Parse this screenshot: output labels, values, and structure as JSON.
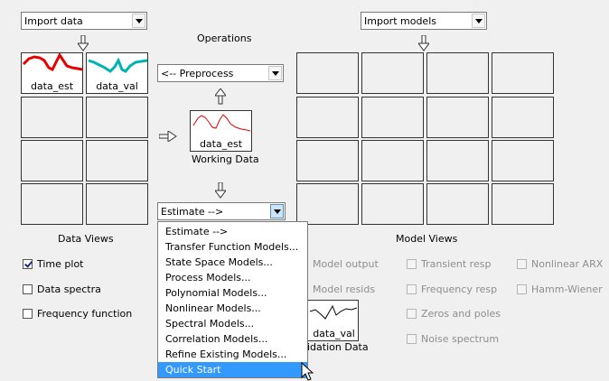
{
  "import_data": {
    "value": "Import data"
  },
  "import_models": {
    "value": "Import models"
  },
  "operations": {
    "title": "Operations",
    "preprocess": "<-- Preprocess",
    "estimate": "Estimate -->"
  },
  "data_views": {
    "title": "Data Views",
    "tiles": [
      {
        "label": "data_est",
        "color": "#e60000"
      },
      {
        "label": "data_val",
        "color": "#00b3b3"
      }
    ],
    "checkboxes": [
      {
        "label": "Time plot",
        "checked": true
      },
      {
        "label": "Data spectra",
        "checked": false
      },
      {
        "label": "Frequency function",
        "checked": false
      }
    ]
  },
  "working_data": {
    "label": "Working Data",
    "tile_label": "data_est",
    "color": "#e60000"
  },
  "validation_data": {
    "label": "idation Data",
    "tile_label": "data_val"
  },
  "model_views": {
    "title": "Model Views",
    "col1": [
      "Model output",
      "Model resids"
    ],
    "col2": [
      "Transient resp",
      "Frequency resp",
      "Zeros and poles",
      "Noise spectrum"
    ],
    "col3": [
      "Nonlinear ARX",
      "Hamm-Wiener"
    ]
  },
  "estimate_menu": {
    "items": [
      "Estimate -->",
      "Transfer Function Models...",
      "State Space Models...",
      "Process Models...",
      "Polynomial Models...",
      "Nonlinear Models...",
      "Spectral Models...",
      "Correlation Models...",
      "Refine Existing Models...",
      "Quick Start"
    ],
    "selected_index": 9
  }
}
